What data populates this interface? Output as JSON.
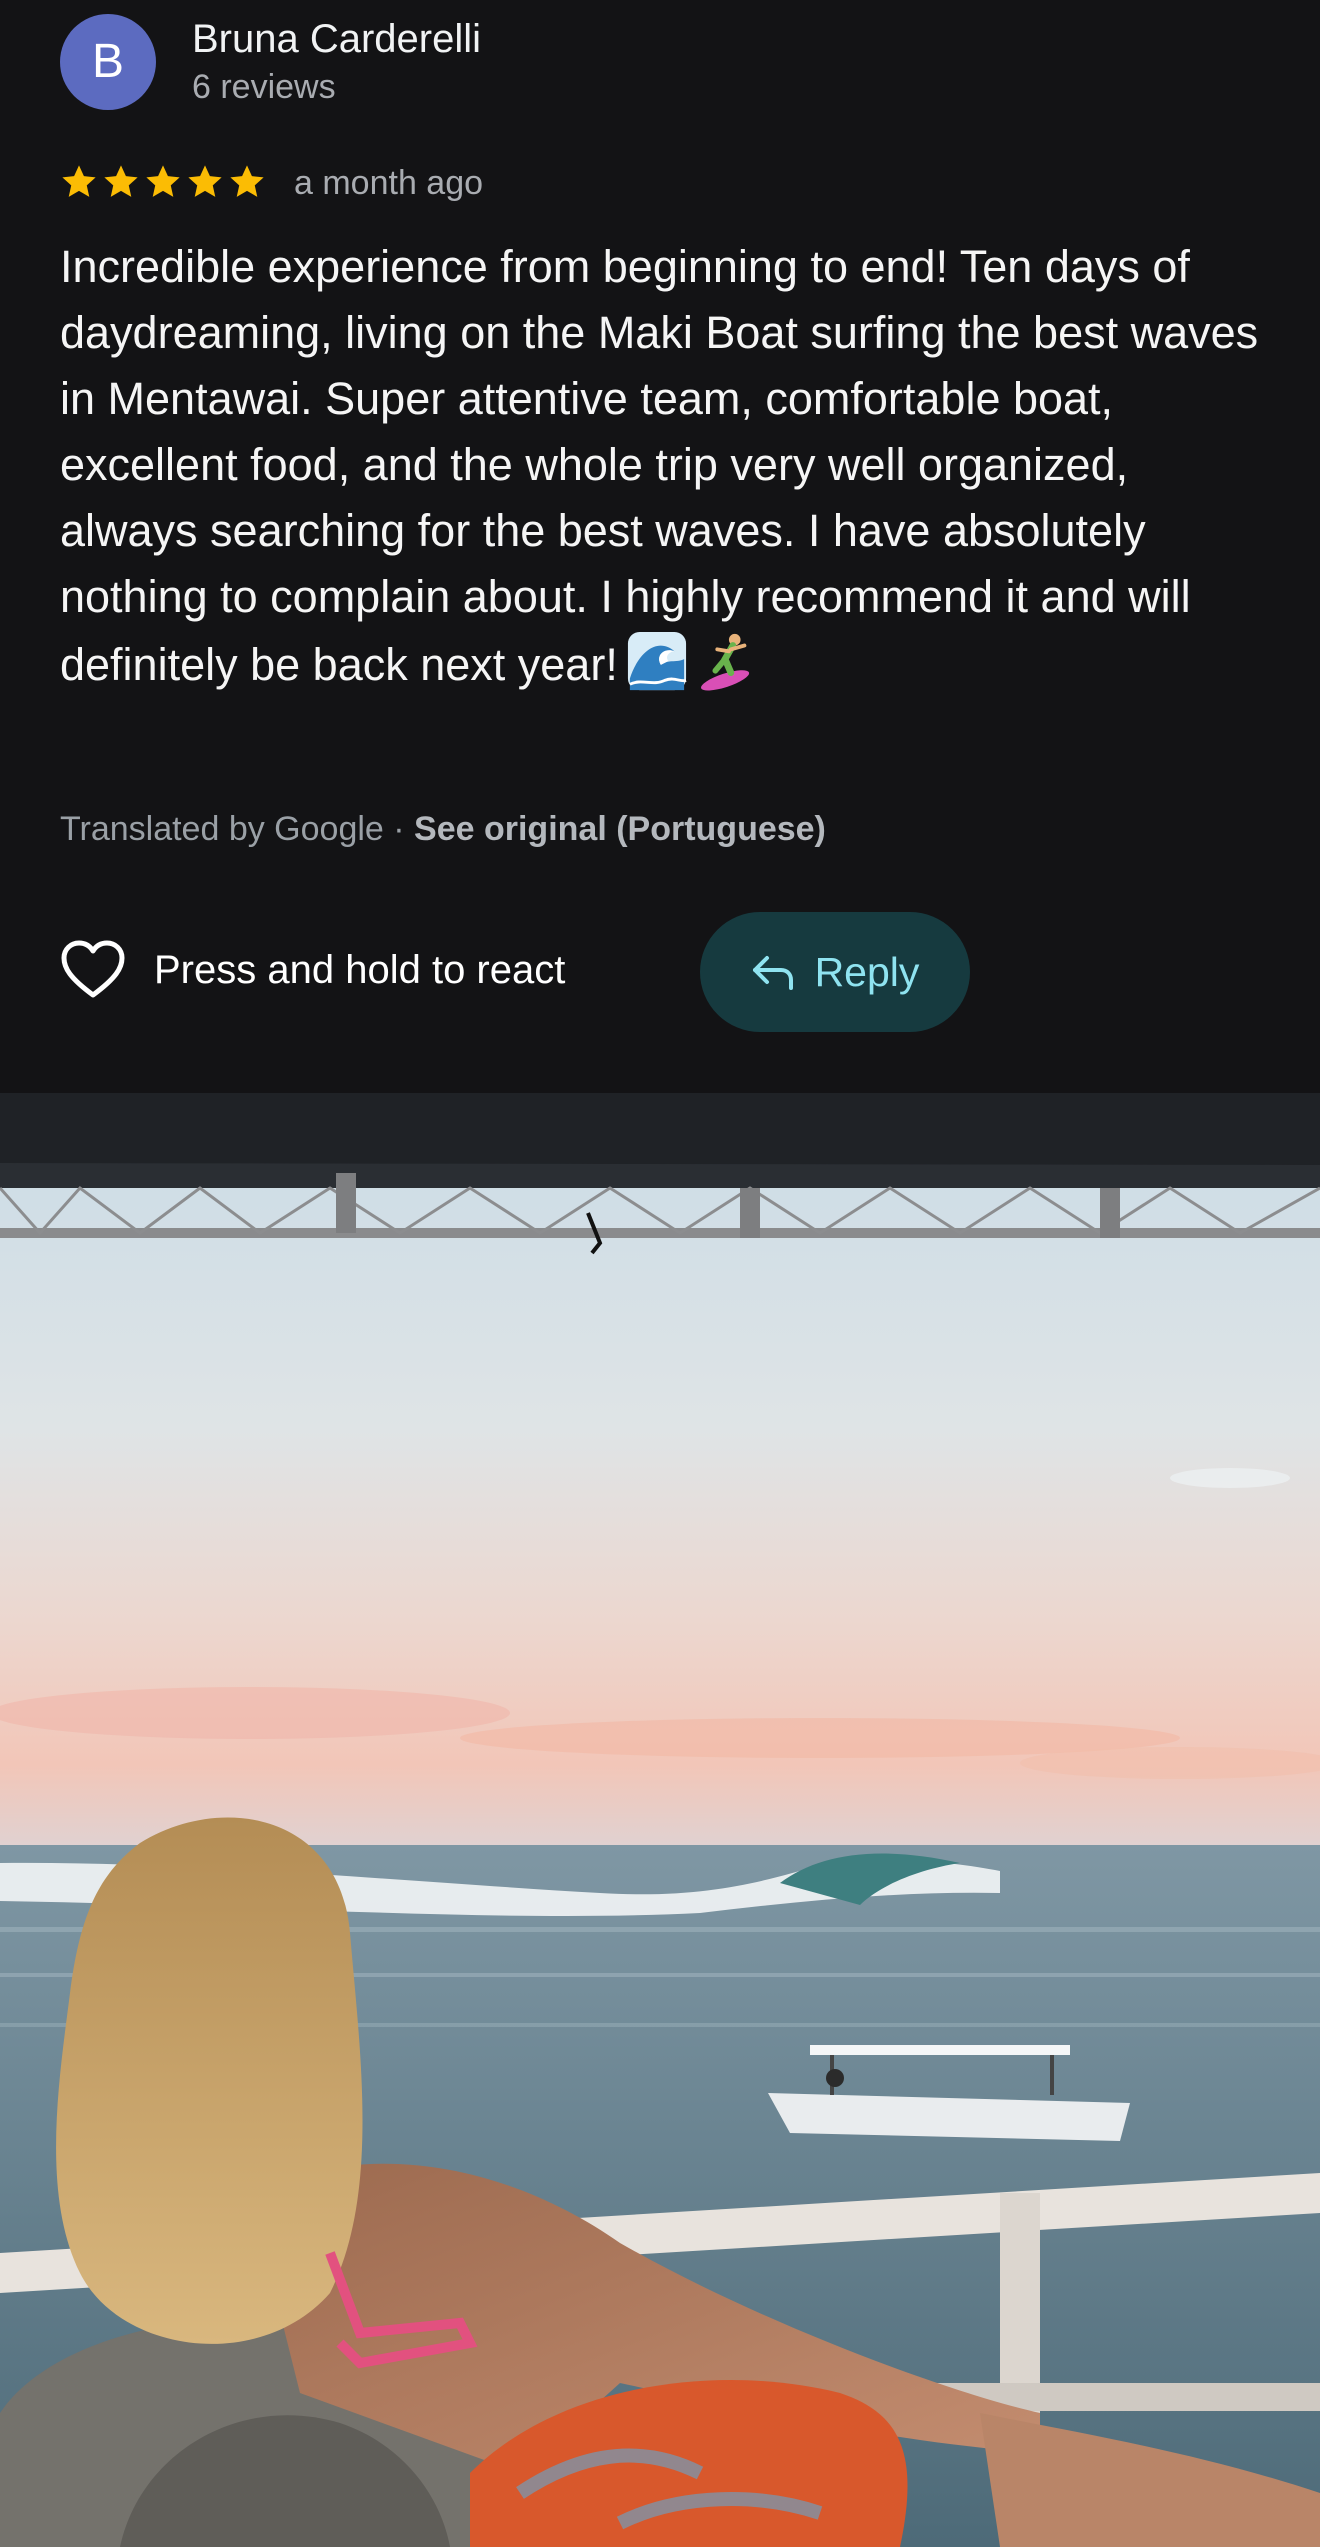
{
  "reviewer": {
    "avatar_letter": "B",
    "avatar_color": "#5c6bc0",
    "name": "Bruna Carderelli",
    "review_count": "6 reviews"
  },
  "rating": {
    "stars": 5,
    "star_color": "#fbbc04",
    "date": "a month ago"
  },
  "review_text": "Incredible experience from beginning to end! Ten days of daydreaming, living on the Maki Boat surfing the best waves in Mentawai. Super attentive team, comfortable boat, excellent food, and the whole trip very well organized, always searching for the best waves. I have absolutely nothing to complain about. I highly recommend it and will definitely be back next year!",
  "review_emojis": [
    "wave-emoji",
    "surfer-emoji"
  ],
  "translation": {
    "prefix": "Translated by Google · ",
    "link": "See original (Portuguese)"
  },
  "actions": {
    "react_label": "Press and hold to react",
    "reply_label": "Reply"
  },
  "colors": {
    "background": "#131315",
    "reply_bg": "#163a3f",
    "reply_text": "#8fe3f0"
  },
  "photo": {
    "description_icon": "review-photo-sunset-surf-boat"
  }
}
